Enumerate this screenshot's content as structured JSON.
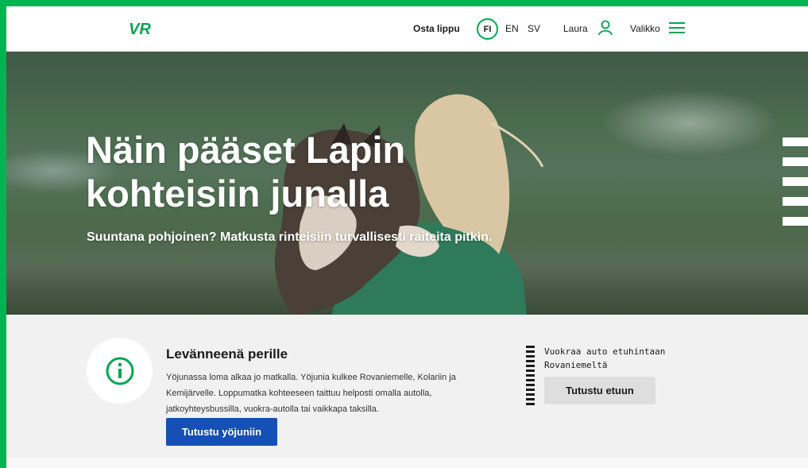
{
  "brand": {
    "logo_text": "VR",
    "accent_color": "#00a651",
    "frame_color": "#00b451"
  },
  "header": {
    "buy_ticket": "Osta lippu",
    "languages": [
      "FI",
      "EN",
      "SV"
    ],
    "active_language": "FI",
    "user_name": "Laura",
    "menu_label": "Valikko"
  },
  "hero": {
    "title": "Näin pääset Lapin kohteisiin junalla",
    "subtitle": "Suuntana pohjoinen? Matkusta rinteisiin turvallisesti raiteita pitkin."
  },
  "info": {
    "icon": "info-icon",
    "title": "Levänneenä perille",
    "body": "Yöjunassa loma alkaa jo matkalla. Yöjunia kulkee Rovaniemelle, Kolariin ja Kemijärvelle. Loppumatka kohteeseen taittuu helposti omalla autolla, jatkoyhteysbussilla, vuokra-autolla tai vaikkapa taksilla.",
    "button": "Tutustu yöjuniin"
  },
  "promo": {
    "text": "Vuokraa auto etuhintaan Rovaniemeltä",
    "button": "Tutustu etuun"
  }
}
